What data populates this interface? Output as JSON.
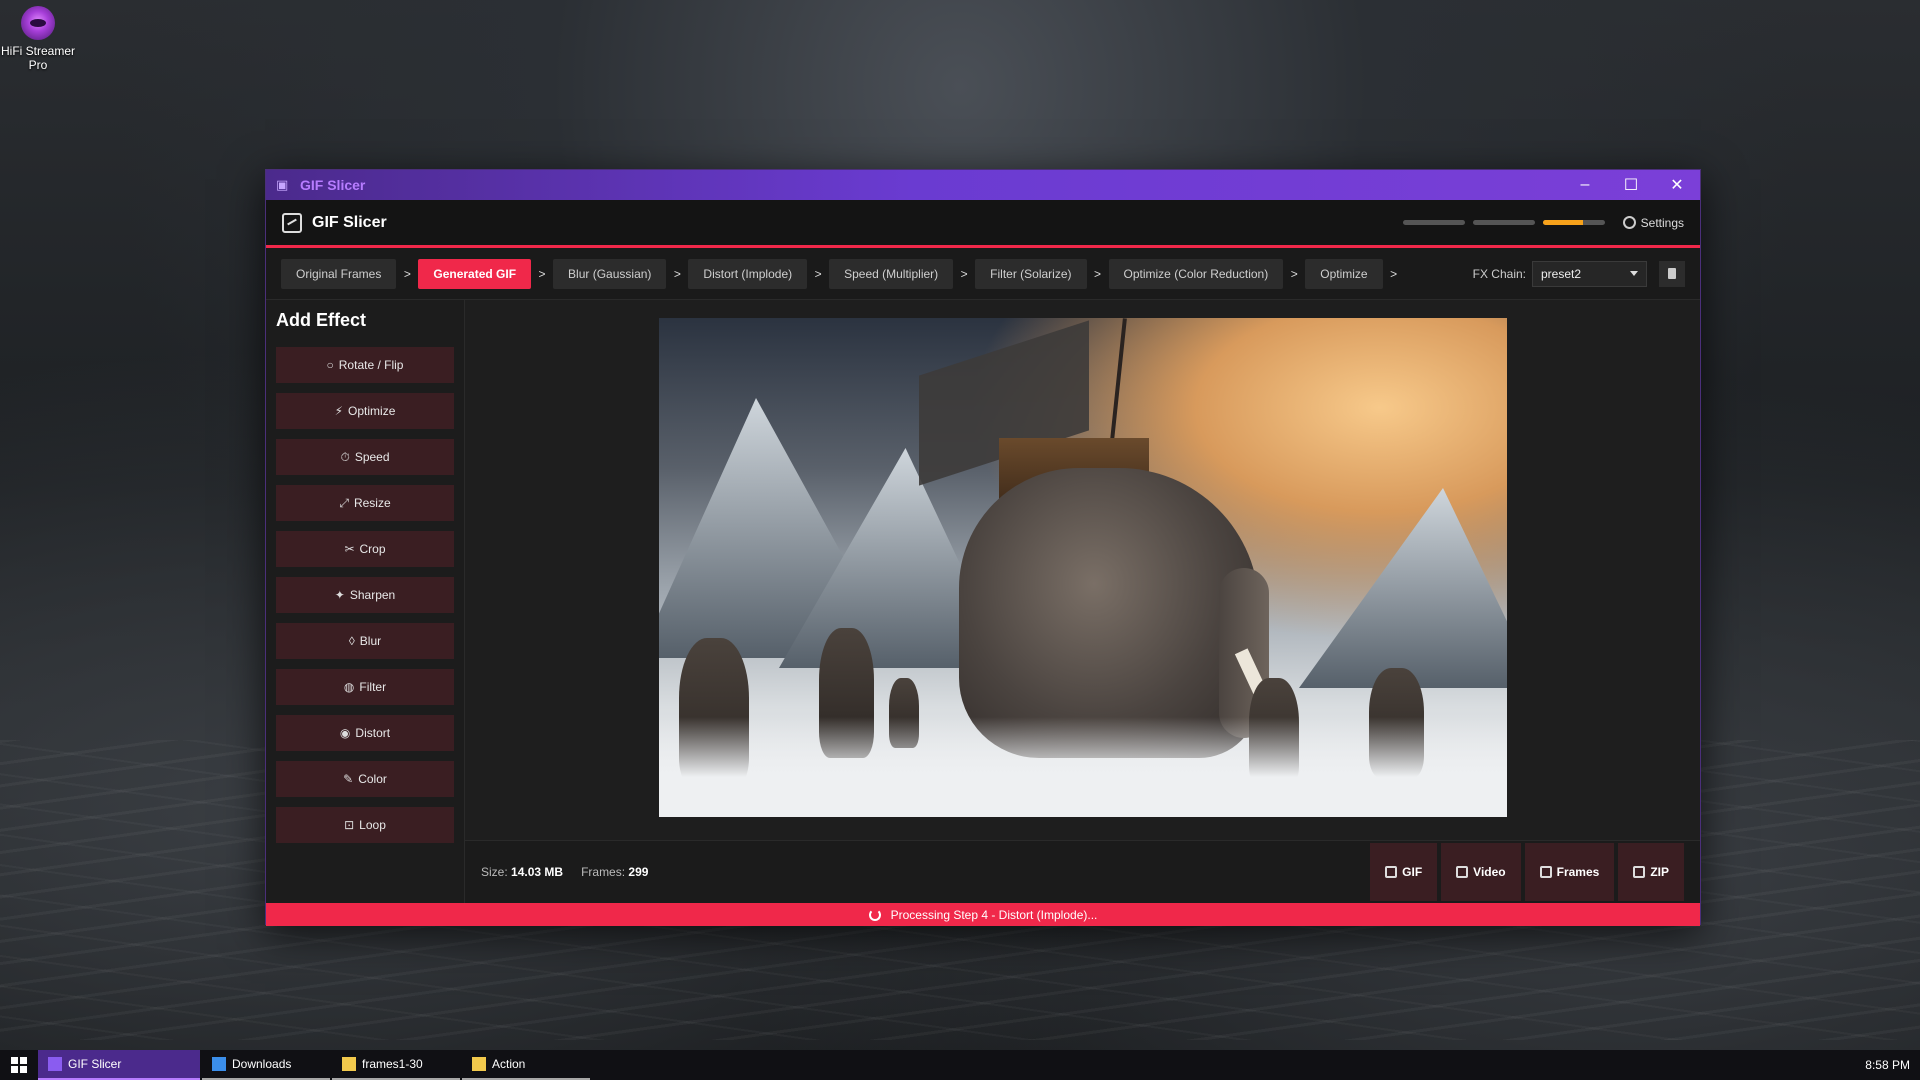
{
  "desktop": {
    "icon_label": "HiFi Streamer Pro"
  },
  "window": {
    "title": "GIF Slicer",
    "controls": {
      "minimize": "–",
      "maximize": "☐",
      "close": "✕"
    }
  },
  "header": {
    "app_name": "GIF Slicer",
    "progress": [
      {
        "fill": 0
      },
      {
        "fill": 0
      },
      {
        "fill": 0.65
      }
    ],
    "settings_label": "Settings"
  },
  "pipeline": {
    "steps": [
      {
        "label": "Original Frames",
        "active": false
      },
      {
        "label": "Generated GIF",
        "active": true
      },
      {
        "label": "Blur (Gaussian)",
        "active": false
      },
      {
        "label": "Distort (Implode)",
        "active": false
      },
      {
        "label": "Speed (Multiplier)",
        "active": false
      },
      {
        "label": "Filter (Solarize)",
        "active": false
      },
      {
        "label": "Optimize (Color Reduction)",
        "active": false
      },
      {
        "label": "Optimize",
        "active": false
      }
    ],
    "separator": ">",
    "fx_chain_label": "FX Chain:",
    "fx_chain_value": "preset2"
  },
  "sidebar": {
    "title": "Add Effect",
    "effects": [
      {
        "label": "Rotate / Flip",
        "icon": "rotate-icon",
        "glyph": "○"
      },
      {
        "label": "Optimize",
        "icon": "bolt-icon",
        "glyph": "⚡"
      },
      {
        "label": "Speed",
        "icon": "stopwatch-icon",
        "glyph": "⏱"
      },
      {
        "label": "Resize",
        "icon": "resize-icon",
        "glyph": "⤢"
      },
      {
        "label": "Crop",
        "icon": "crop-icon",
        "glyph": "✂"
      },
      {
        "label": "Sharpen",
        "icon": "sharpen-icon",
        "glyph": "✦"
      },
      {
        "label": "Blur",
        "icon": "droplet-icon",
        "glyph": "◊"
      },
      {
        "label": "Filter",
        "icon": "palette-icon",
        "glyph": "◍"
      },
      {
        "label": "Distort",
        "icon": "distort-icon",
        "glyph": "◉"
      },
      {
        "label": "Color",
        "icon": "brush-icon",
        "glyph": "✎"
      },
      {
        "label": "Loop",
        "icon": "loop-icon",
        "glyph": "⊡"
      }
    ]
  },
  "info": {
    "size_label": "Size:",
    "size_value": "14.03 MB",
    "frames_label": "Frames:",
    "frames_value": "299"
  },
  "downloads": [
    {
      "label": "GIF",
      "icon": "save-icon"
    },
    {
      "label": "Video",
      "icon": "video-icon"
    },
    {
      "label": "Frames",
      "icon": "image-icon"
    },
    {
      "label": "ZIP",
      "icon": "archive-icon"
    }
  ],
  "status": {
    "text": "Processing Step 4 - Distort (Implode)..."
  },
  "taskbar": {
    "items": [
      {
        "label": "GIF Slicer",
        "active": true,
        "icon": "app-icon"
      },
      {
        "label": "Downloads",
        "active": false,
        "icon": "download-arrow-icon"
      },
      {
        "label": "frames1-30",
        "active": false,
        "icon": "folder-icon"
      },
      {
        "label": "Action",
        "active": false,
        "icon": "folder-icon"
      }
    ],
    "clock": "8:58 PM"
  },
  "colors": {
    "accent": "#f0284a",
    "titlebar": "#6a3bd1",
    "effect_button": "#3a1e22",
    "progress": "#f7a21b"
  }
}
